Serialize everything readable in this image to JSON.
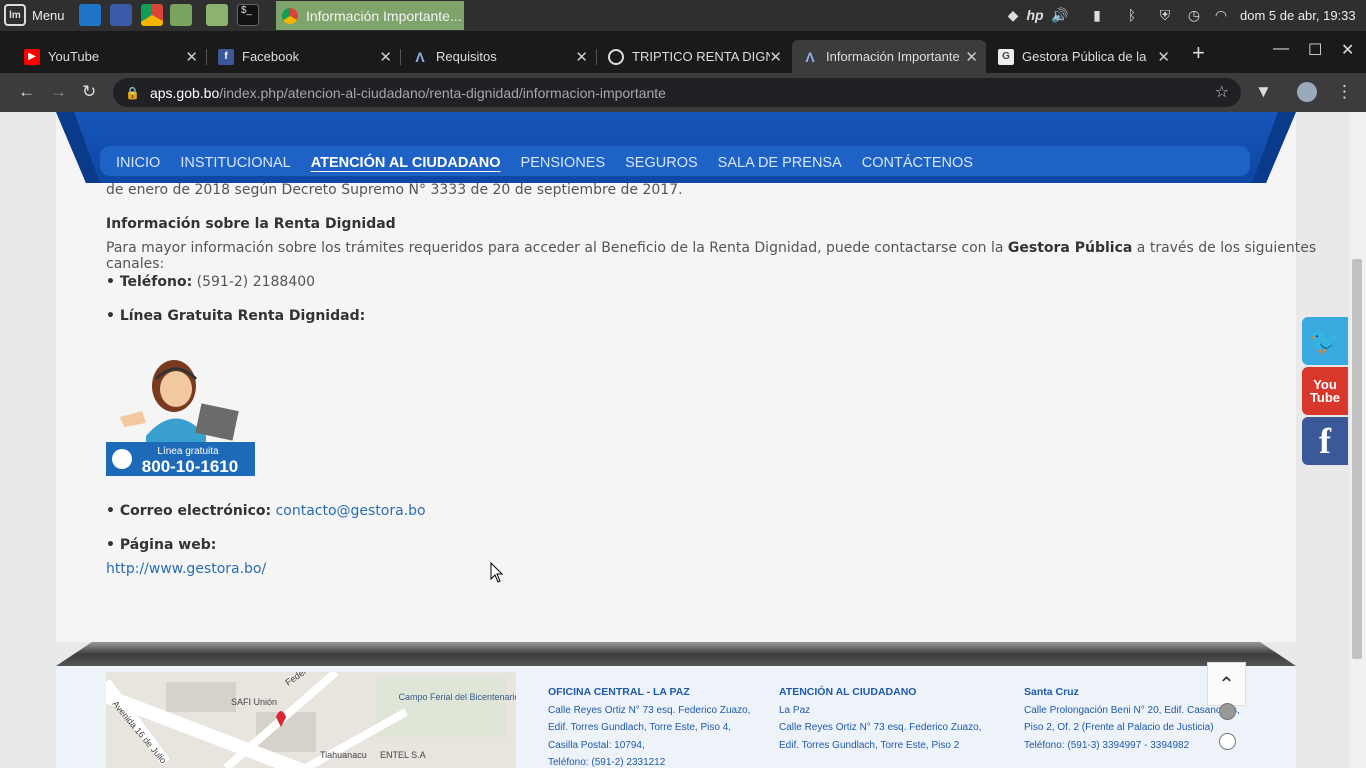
{
  "taskbar": {
    "menu_label": "Menu",
    "active_task": "Información Importante...",
    "clock": "dom  5 de abr, 19:33"
  },
  "tabs": [
    {
      "title": "YouTube",
      "icon": "youtube-icon"
    },
    {
      "title": "Facebook",
      "icon": "facebook-icon"
    },
    {
      "title": "Requisitos",
      "icon": "aps-icon"
    },
    {
      "title": "TRIPTICO RENTA DIGNI",
      "icon": "globe-icon"
    },
    {
      "title": "Información Importante",
      "icon": "aps-icon",
      "active": true
    },
    {
      "title": "Gestora Pública de la",
      "icon": "gestora-icon"
    }
  ],
  "address": {
    "host": "aps.gob.bo",
    "path": "/index.php/atencion-al-ciudadano/renta-dignidad/informacion-importante"
  },
  "site_nav": [
    "INICIO",
    "INSTITUCIONAL",
    "ATENCIÓN AL CIUDADANO",
    "PENSIONES",
    "SEGUROS",
    "SALA DE PRENSA",
    "CONTÁCTENOS"
  ],
  "content": {
    "intro_tail": "de enero de 2018 según Decreto Supremo N° 3333 de 20 de septiembre de 2017.",
    "section_title": "Información sobre la Renta Dignidad",
    "para_before": "Para mayor información sobre los trámites requeridos para acceder al Beneficio de la Renta Dignidad, puede contactarse con la ",
    "para_bold": "Gestora Pública",
    "para_after": " a través de los siguientes canales:",
    "phone_label": "• Teléfono:",
    "phone_value": " (591-2) 2188400",
    "free_line_label": "• Línea Gratuita Renta Dignidad:",
    "promo_caption": "Línea gratuita",
    "promo_number": "800-10-1610",
    "email_label": "• Correo electrónico:",
    "email_value": "contacto@gestora.bo",
    "web_label": "• Página web:",
    "web_value": "http://www.gestora.bo/"
  },
  "footer": {
    "col1": {
      "title": "OFICINA CENTRAL - LA PAZ",
      "lines": [
        "Calle Reyes Ortiz N° 73 esq. Federico Zuazo,",
        "Edif. Torres Gundlach, Torre Este, Piso 4,",
        "Casilla Postal: 10794,",
        "Teléfono: (591-2) 2331212"
      ]
    },
    "col2": {
      "title": "ATENCIÓN AL CIUDADANO",
      "lines": [
        "La Paz",
        "Calle Reyes Ortiz N° 73 esq. Federico Zuazo,",
        "Edif. Torres Gundlach, Torre Este, Piso 2"
      ]
    },
    "col3": {
      "title": "Santa Cruz",
      "lines": [
        "Calle Prolongación Beni N° 20, Edif. Casanovas,",
        "Piso 2, Of. 2 (Frente al Palacio de Justicia)",
        "Teléfono: (591-3) 3394997 - 3394982"
      ]
    },
    "map_labels": [
      "Avenida 16 de Julio",
      "SAFI Unión",
      "Federico Zuazo",
      "Campo Ferial del Bicentenario",
      "Tiahuanacu",
      "ENTEL S.A"
    ]
  },
  "social": {
    "youtube_text_1": "You",
    "youtube_text_2": "Tube"
  }
}
